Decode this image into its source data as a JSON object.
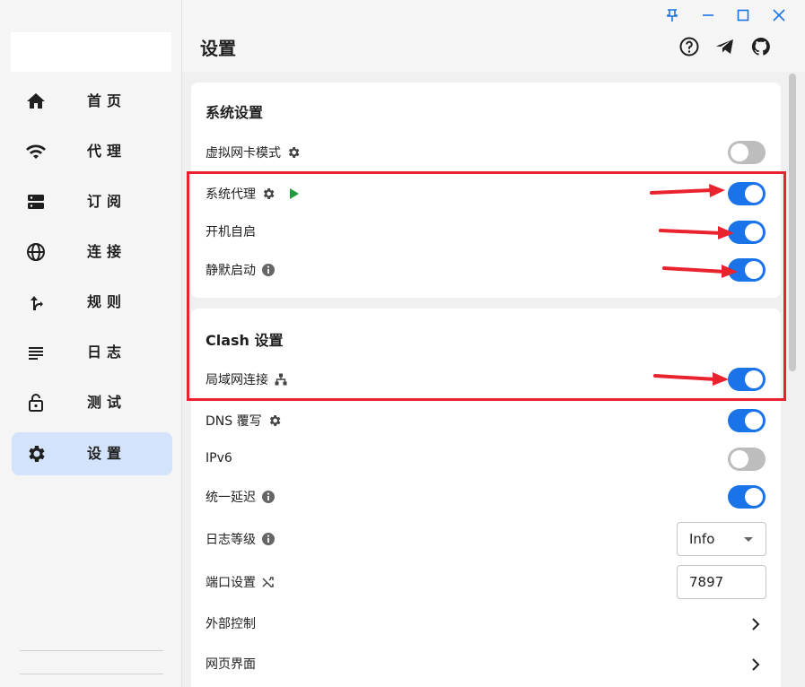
{
  "window_controls": [
    "pin-icon",
    "minimize-icon",
    "maximize-icon",
    "close-icon"
  ],
  "sidebar": {
    "items": [
      {
        "label": "首页",
        "icon": "home-icon"
      },
      {
        "label": "代理",
        "icon": "wifi-icon"
      },
      {
        "label": "订阅",
        "icon": "server-icon"
      },
      {
        "label": "连接",
        "icon": "globe-icon"
      },
      {
        "label": "规则",
        "icon": "fork-icon"
      },
      {
        "label": "日志",
        "icon": "list-icon"
      },
      {
        "label": "测试",
        "icon": "lock-icon"
      },
      {
        "label": "设置",
        "icon": "gear-icon",
        "active": true
      }
    ]
  },
  "header": {
    "title": "设置",
    "icons": [
      "help-icon",
      "telegram-icon",
      "github-icon"
    ]
  },
  "system_settings": {
    "title": "系统设置",
    "tun_mode": {
      "label": "虚拟网卡模式",
      "enabled": false
    },
    "system_proxy": {
      "label": "系统代理",
      "enabled": true
    },
    "auto_launch": {
      "label": "开机自启",
      "enabled": true
    },
    "silent_start": {
      "label": "静默启动",
      "enabled": true
    }
  },
  "clash_settings": {
    "title": "Clash 设置",
    "allow_lan": {
      "label": "局域网连接",
      "enabled": true
    },
    "dns_override": {
      "label": "DNS 覆写",
      "enabled": true
    },
    "ipv6": {
      "label": "IPv6",
      "enabled": false
    },
    "unified_delay": {
      "label": "统一延迟",
      "enabled": true
    },
    "log_level": {
      "label": "日志等级",
      "value": "Info"
    },
    "port": {
      "label": "端口设置",
      "value": "7897"
    },
    "external_controller": {
      "label": "外部控制"
    },
    "web_ui": {
      "label": "网页界面"
    }
  },
  "colors": {
    "accent": "#1a73e8",
    "active_nav": "#d3e3fb",
    "annotation_red": "#e8232e",
    "play_green": "#1e9e3a"
  }
}
